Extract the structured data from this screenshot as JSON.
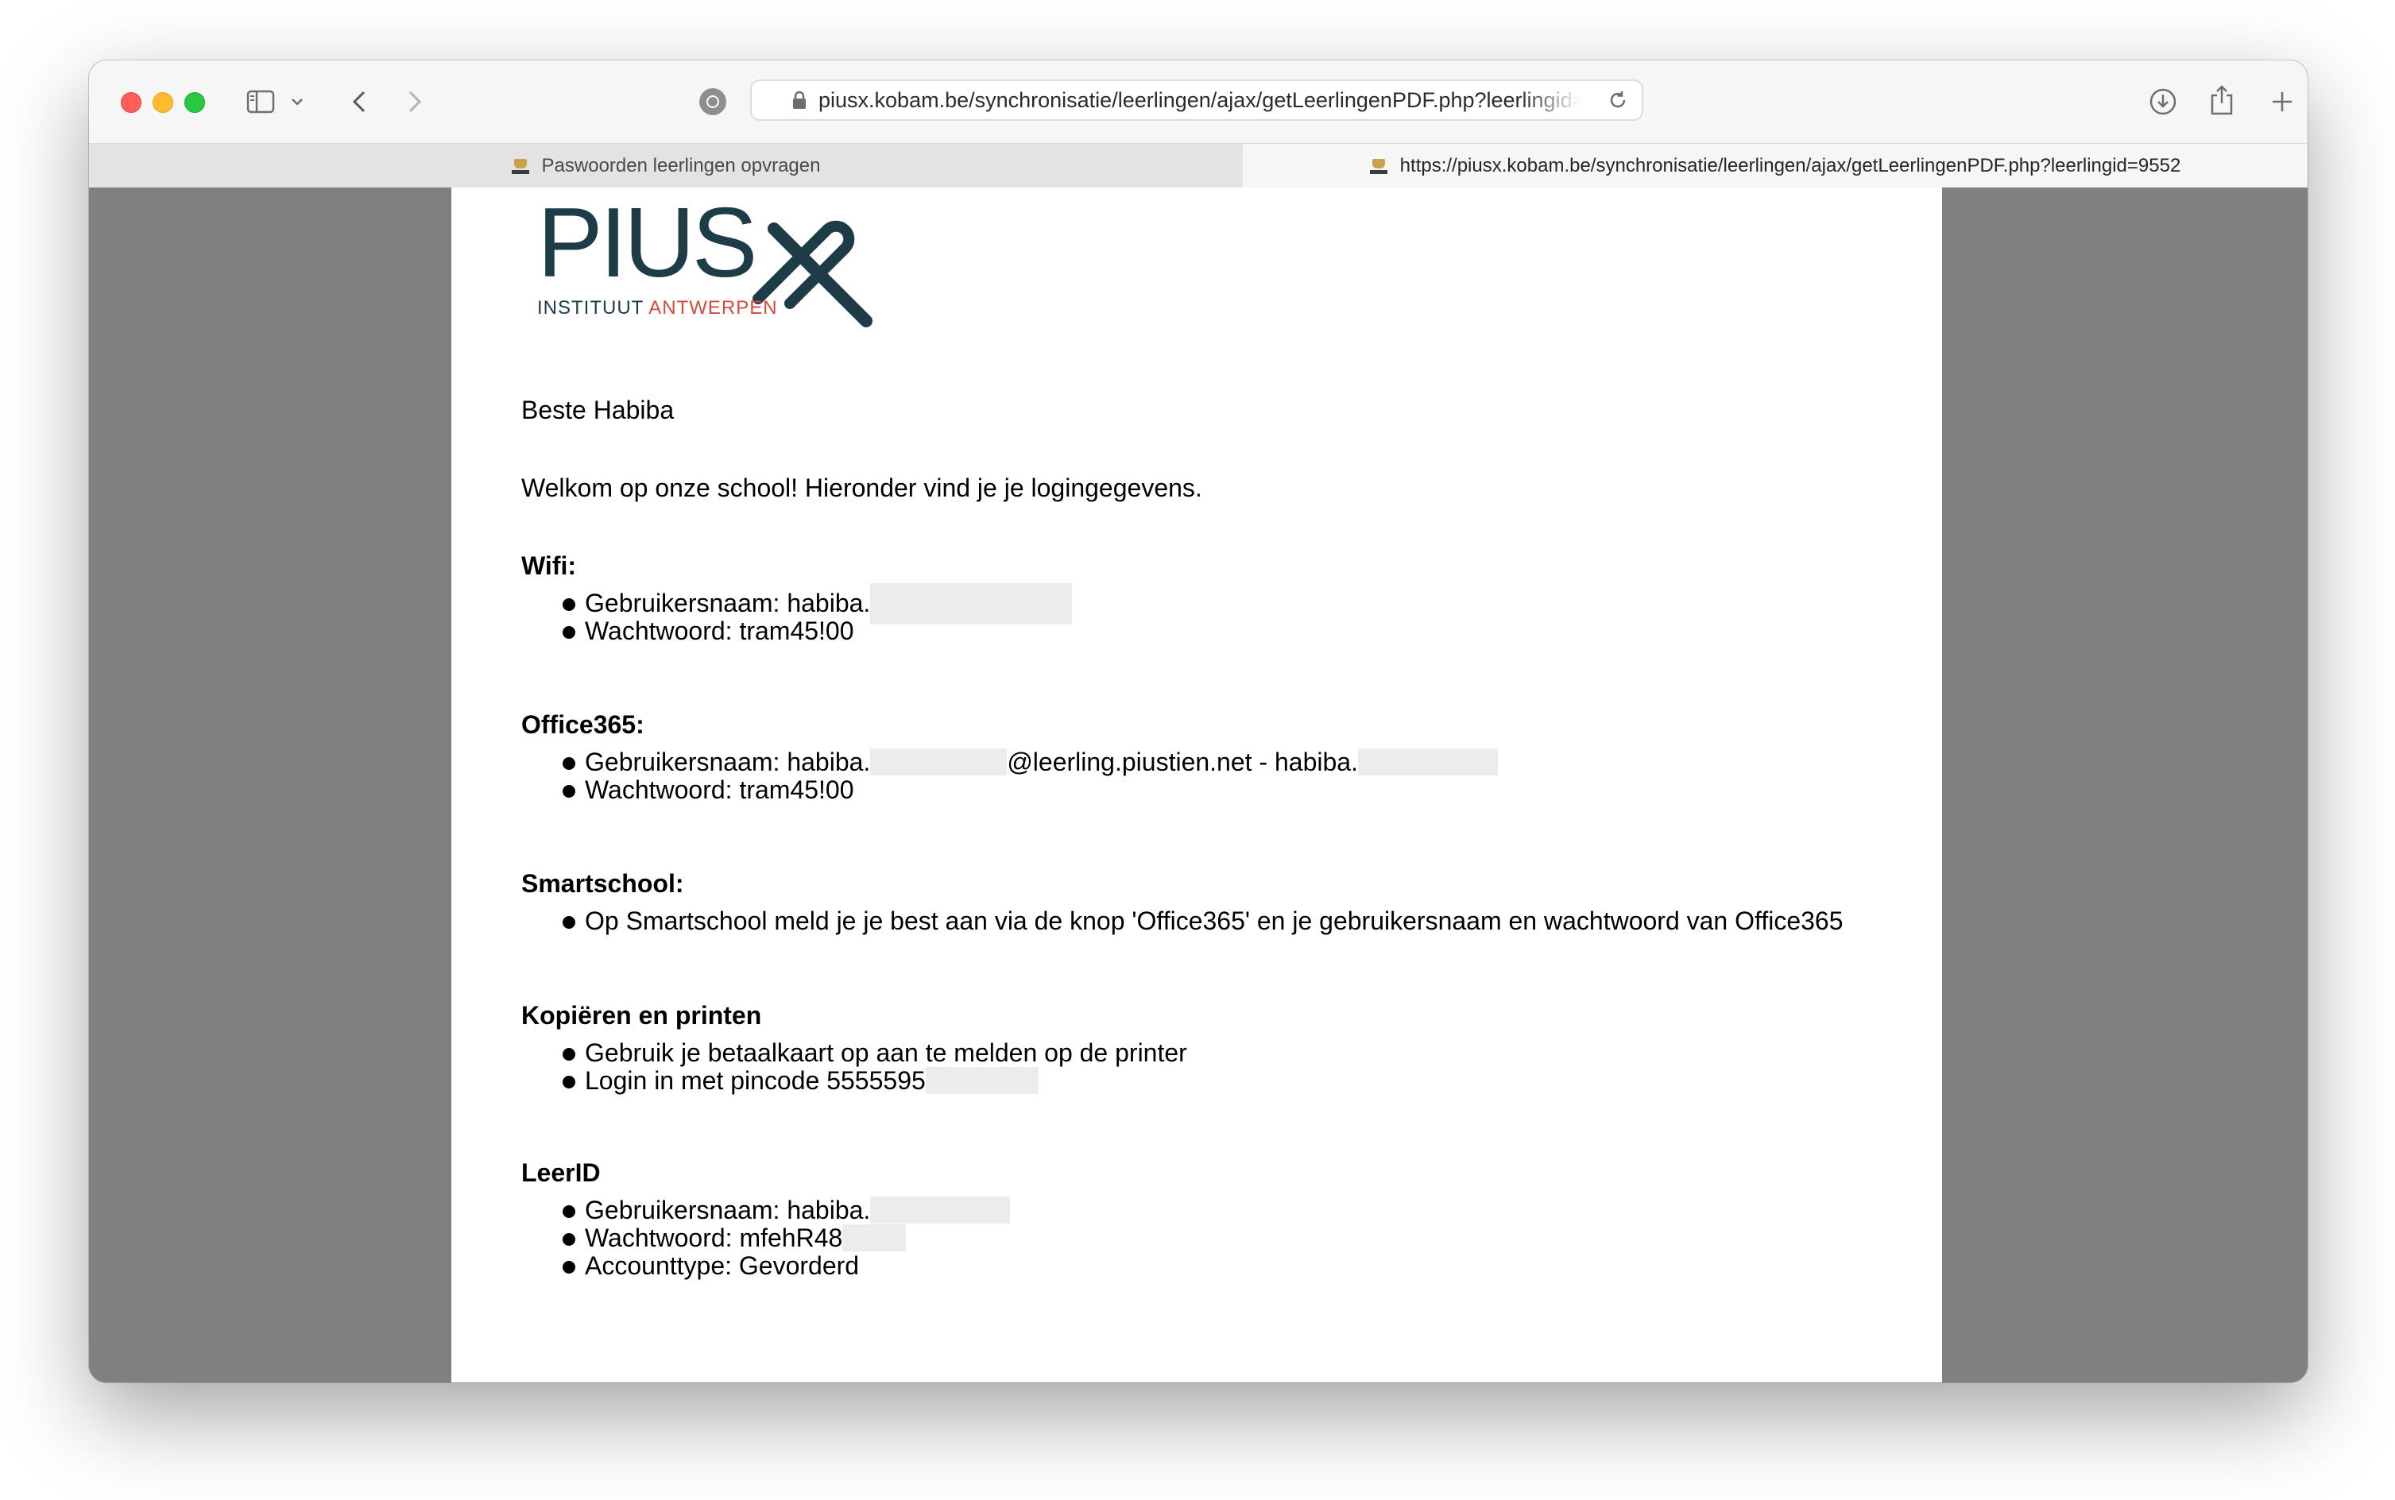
{
  "browser": {
    "address_url": "piusx.kobam.be/synchronisatie/leerlingen/ajax/getLeerlingenPDF.php?leerlingid=95",
    "tabs": [
      {
        "title": "Paswoorden leerlingen opvragen"
      },
      {
        "title": "https://piusx.kobam.be/synchronisatie/leerlingen/ajax/getLeerlingenPDF.php?leerlingid=9552"
      }
    ]
  },
  "logo": {
    "main": "PIUS",
    "sub_a": "INSTITUUT ",
    "sub_b": "ANTWERPEN"
  },
  "document": {
    "greeting": "Beste Habiba",
    "intro": "Welkom op onze school! Hieronder vind je je logingegevens.",
    "wifi": {
      "heading": "Wifi:",
      "items": [
        "Gebruikersnaam: habiba.",
        "Wachtwoord: tram45!00"
      ]
    },
    "office": {
      "heading": "Office365:",
      "user_prefix": "Gebruikersnaam: habiba.",
      "user_domain": "@leerling.piustien.net - habiba.",
      "password": "Wachtwoord: tram45!00"
    },
    "smartschool": {
      "heading": "Smartschool:",
      "items": [
        "Op Smartschool meld je je best aan via de knop 'Office365' en je gebruikersnaam en wachtwoord van Office365"
      ]
    },
    "print": {
      "heading": "Kopiëren en printen",
      "items": [
        "Gebruik je betaalkaart op aan te melden op de printer",
        "Login in met pincode 5555595"
      ]
    },
    "leerid": {
      "heading": "LeerID",
      "items": [
        "Gebruikersnaam: habiba.",
        "Wachtwoord: mfehR48",
        "Accounttype: Gevorderd"
      ]
    }
  }
}
